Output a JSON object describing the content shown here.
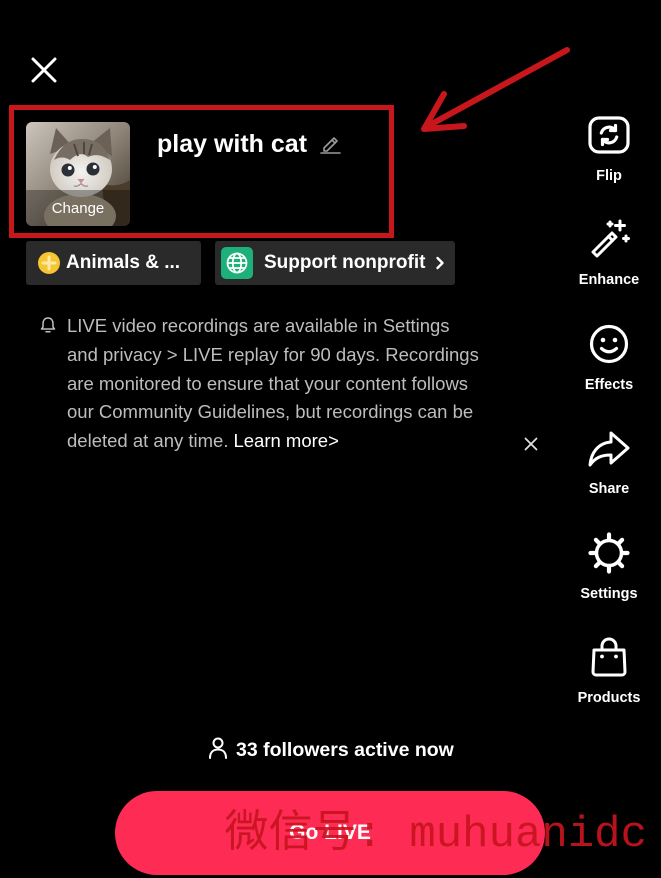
{
  "header": {
    "close_icon": "close-icon"
  },
  "live_setup": {
    "cover": {
      "change_label": "Change"
    },
    "title": "play with cat",
    "edit_icon": "pencil-icon",
    "chips": [
      {
        "icon": "plus-circle-icon",
        "icon_color": "#F6C532",
        "label": "Animals & ..."
      },
      {
        "icon": "globe-icon",
        "icon_color": "#1DB07B",
        "label": "Support nonprofit",
        "trailing_icon": "chevron-right-icon"
      }
    ]
  },
  "notice": {
    "icon": "bell-icon",
    "lines": [
      "LIVE video recordings are available in Settings",
      "and privacy > LIVE replay for 90 days. Recordings",
      "are monitored to ensure that your content follows",
      "our Community Guidelines, but recordings can be",
      "deleted at any time."
    ],
    "link": "Learn more>",
    "dismiss_icon": "close-icon"
  },
  "toolbar": {
    "items": [
      {
        "label": "Flip",
        "icon": "flip-camera-icon"
      },
      {
        "label": "Enhance",
        "icon": "magic-wand-icon"
      },
      {
        "label": "Effects",
        "icon": "smiley-icon"
      },
      {
        "label": "Share",
        "icon": "share-arrow-icon"
      },
      {
        "label": "Settings",
        "icon": "gear-icon"
      },
      {
        "label": "Products",
        "icon": "shopping-bag-icon"
      }
    ]
  },
  "followers": {
    "icon": "person-icon",
    "text": "33 followers active now"
  },
  "go_live": {
    "label": "Go LIVE"
  },
  "watermark": "微信号: muhuanidc",
  "colors": {
    "background": "#000000",
    "text": "#FFFFFF",
    "muted_text": "#BDBDBD",
    "chip_background": "#2A2A2A",
    "go_live": "#FE2C55",
    "annotation": "#C8161D",
    "watermark": "#C8141E"
  }
}
